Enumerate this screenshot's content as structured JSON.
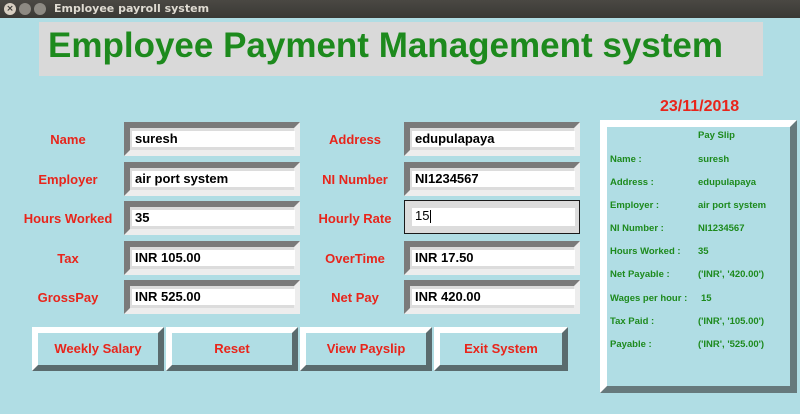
{
  "window": {
    "title": "Employee payroll system"
  },
  "banner": {
    "title": "Employee Payment Management system"
  },
  "date": "23/11/2018",
  "form": {
    "name": {
      "label": "Name",
      "value": "suresh"
    },
    "employer": {
      "label": "Employer",
      "value": "air port system"
    },
    "hours_worked": {
      "label": "Hours Worked",
      "value": "35"
    },
    "tax": {
      "label": "Tax",
      "value": "INR 105.00"
    },
    "gross_pay": {
      "label": "GrossPay",
      "value": "INR 525.00"
    },
    "address": {
      "label": "Address",
      "value": "edupulapaya"
    },
    "ni_number": {
      "label": "NI Number",
      "value": "NI1234567"
    },
    "hourly_rate": {
      "label": "Hourly Rate",
      "value": "15"
    },
    "overtime": {
      "label": "OverTime",
      "value": "INR 17.50"
    },
    "net_pay": {
      "label": "Net Pay",
      "value": "INR 420.00"
    }
  },
  "buttons": {
    "weekly_salary": "Weekly Salary",
    "reset": "Reset",
    "view_payslip": "View Payslip",
    "exit": "Exit System"
  },
  "payslip": {
    "title": "Pay Slip",
    "rows": [
      {
        "label": "Name :",
        "value": "suresh"
      },
      {
        "label": "Address :",
        "value": "edupulapaya"
      },
      {
        "label": "Employer :",
        "value": "air port system"
      },
      {
        "label": "NI Number :",
        "value": "NI1234567"
      },
      {
        "label": "Hours Worked :",
        "value": "35"
      },
      {
        "label": "Net Payable :",
        "value": "('INR', '420.00')"
      },
      {
        "label": "Wages per hour :",
        "value": "15"
      },
      {
        "label": "Tax Paid :",
        "value": "('INR', '105.00')"
      },
      {
        "label": "Payable :",
        "value": "('INR', '525.00')"
      }
    ]
  },
  "colors": {
    "background": "#b0dde4",
    "label_red": "#e8251b",
    "title_green": "#1d8a1d"
  }
}
